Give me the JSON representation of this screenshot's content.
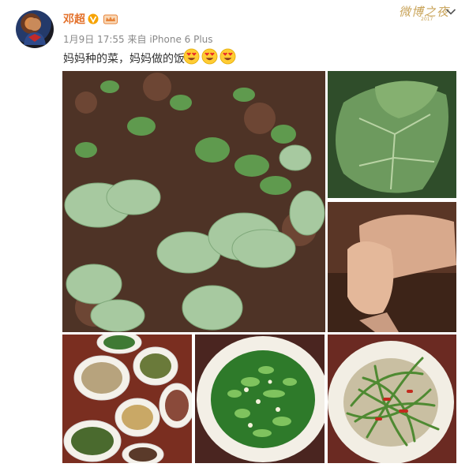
{
  "post": {
    "username": "邓超",
    "time": "1月9日 17:55",
    "source_prefix": "来自",
    "source": "iPhone 6 Plus",
    "text": "妈妈种的菜，妈妈做的饭",
    "emoji_name": "heart-eyes-emoji",
    "emoji_count": 3
  },
  "brand": {
    "name": "微博之夜",
    "year": "2017"
  },
  "icons": {
    "verified": "verified-badge-icon",
    "member": "member-crown-icon",
    "menu": "chevron-down-icon"
  },
  "colors": {
    "username": "#e3702a",
    "verified": "#f7a300",
    "meta": "#888888",
    "brand": "#c9a45a"
  },
  "photos": [
    {
      "name": "photo-vegetable-garden"
    },
    {
      "name": "photo-leaf-closeup"
    },
    {
      "name": "photo-holding-hands"
    },
    {
      "name": "photo-table-dishes"
    },
    {
      "name": "photo-stir-fried-greens"
    },
    {
      "name": "photo-greens-with-peppers"
    }
  ]
}
